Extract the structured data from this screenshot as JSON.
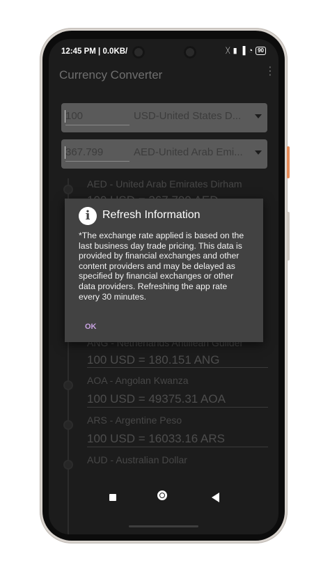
{
  "status_bar": {
    "time": "12:45 PM | 0.0KB/",
    "icons": [
      "bluetooth-icon",
      "vibrate-icon",
      "signal-icon",
      "wifi-icon",
      "battery-icon"
    ],
    "battery": "90"
  },
  "app_bar": {
    "title": "Currency Converter",
    "menu_icon": "more-vert-icon"
  },
  "converter": {
    "from": {
      "amount": "100",
      "currency": "USD-United States D..."
    },
    "to": {
      "amount": "367.799",
      "currency": "AED-United Arab Emi..."
    }
  },
  "rates": [
    {
      "name": "AED - United Arab Emirates Dirham",
      "value": "100 USD = 367.799 AED"
    },
    {
      "name": "ANG - Netherlands Antillean Guilder",
      "value": "100 USD = 180.151 ANG"
    },
    {
      "name": "AOA - Angolan Kwanza",
      "value": "100 USD = 49375.31 AOA"
    },
    {
      "name": "ARS - Argentine Peso",
      "value": "100 USD = 16033.16 ARS"
    },
    {
      "name": "AUD - Australian Dollar",
      "value": ""
    }
  ],
  "dialog": {
    "icon": "info-icon",
    "title": "Refresh Information",
    "message": "*The exchange rate applied is based on the last business day trade pricing. This data is provided by financial exchanges and other content providers and may be delayed as specified by financial exchanges or other data providers. Refreshing the app rate every 30 minutes.",
    "ok_label": "OK"
  },
  "nav": {
    "recents": "recents-icon",
    "home": "home-icon",
    "back": "back-icon"
  },
  "colors": {
    "dialog_bg": "#424242",
    "accent": "#c9a3e2",
    "screen_bg": "#1c1c1c"
  }
}
